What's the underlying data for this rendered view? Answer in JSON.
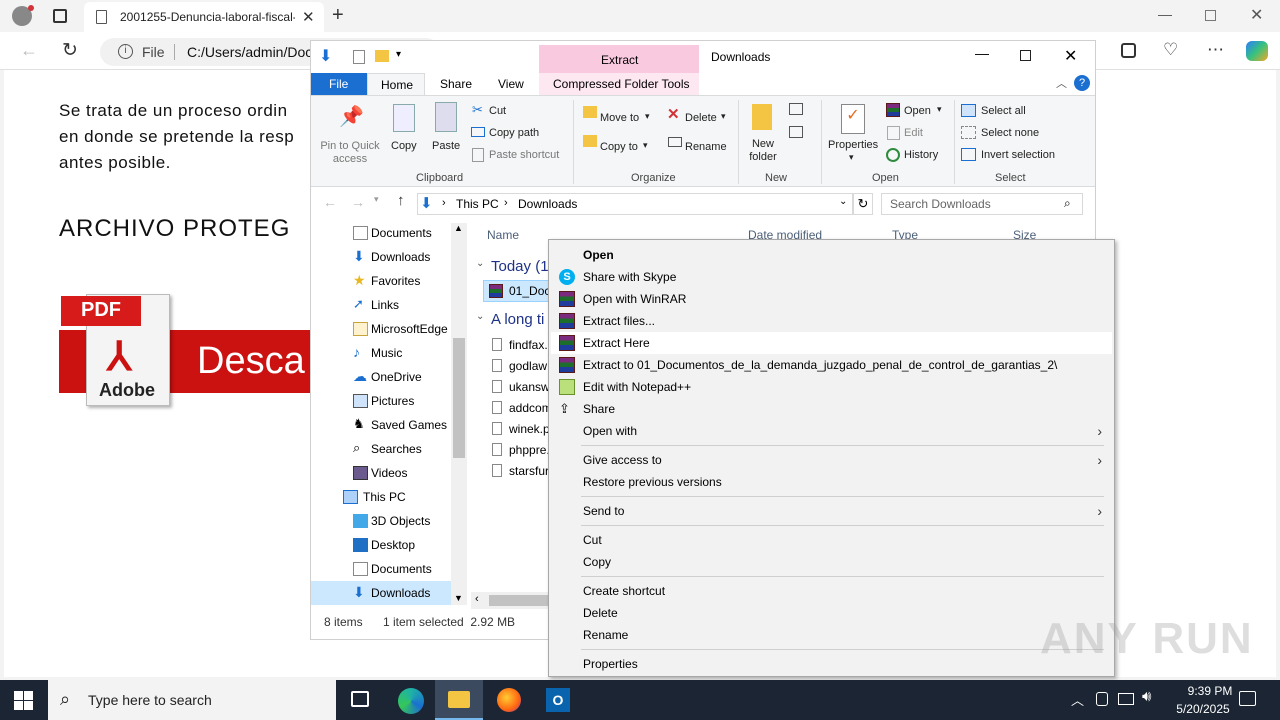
{
  "browser": {
    "tab_title": "2001255-Denuncia-laboral-fiscal-",
    "address_scheme": "File",
    "address_text": "C:/Users/admin/Doc"
  },
  "webpage": {
    "para_lines": [
      "Se trata de un proceso ordin",
      "en donde se pretende la resp",
      "antes posible."
    ],
    "heading": "ARCHIVO PROTEG",
    "pdf_label": "PDF",
    "adobe_label": "Adobe",
    "download_label": "Desca"
  },
  "explorer": {
    "ribbon_context_tab": "Extract",
    "window_title": "Downloads",
    "tabs": [
      "File",
      "Home",
      "Share",
      "View",
      "Compressed Folder Tools"
    ],
    "clipboard": {
      "pin": "Pin to Quick access",
      "copy": "Copy",
      "paste": "Paste",
      "cut": "Cut",
      "copy_path": "Copy path",
      "paste_shortcut": "Paste shortcut",
      "group": "Clipboard"
    },
    "organize": {
      "move_to": "Move to",
      "copy_to": "Copy to",
      "delete": "Delete",
      "rename": "Rename",
      "group": "Organize"
    },
    "new": {
      "new_folder": "New folder",
      "group": "New"
    },
    "open": {
      "properties": "Properties",
      "open": "Open",
      "edit": "Edit",
      "history": "History",
      "group": "Open"
    },
    "select": {
      "select_all": "Select all",
      "select_none": "Select none",
      "invert": "Invert selection",
      "group": "Select"
    },
    "path": [
      "This PC",
      "Downloads"
    ],
    "search_placeholder": "Search Downloads",
    "columns": [
      "Name",
      "Date modified",
      "Type",
      "Size"
    ],
    "groups": [
      "Today (1",
      "A long ti"
    ],
    "today_file": "01_Doc",
    "old_files": [
      "findfax.",
      "godlaw",
      "ukansw",
      "addcom",
      "winek.p",
      "phppre.",
      "starsfur"
    ],
    "nav_items": [
      "Documents",
      "Downloads",
      "Favorites",
      "Links",
      "MicrosoftEdge",
      "Music",
      "OneDrive",
      "Pictures",
      "Saved Games",
      "Searches",
      "Videos",
      "This PC",
      "3D Objects",
      "Desktop",
      "Documents",
      "Downloads"
    ],
    "status_count": "8 items",
    "status_selected": "1 item selected  2.92 MB"
  },
  "context_menu": [
    {
      "label": "Open",
      "bold": true
    },
    {
      "label": "Share with Skype"
    },
    {
      "label": "Open with WinRAR"
    },
    {
      "label": "Extract files..."
    },
    {
      "label": "Extract Here"
    },
    {
      "label": "Extract to 01_Documentos_de_la_demanda_juzgado_penal_de_control_de_garantias_2\\"
    },
    {
      "label": "Edit with Notepad++"
    },
    {
      "label": "Share"
    },
    {
      "label": "Open with"
    },
    {
      "label": "Give access to"
    },
    {
      "label": "Restore previous versions"
    },
    {
      "label": "Send to"
    },
    {
      "label": "Cut"
    },
    {
      "label": "Copy"
    },
    {
      "label": "Create shortcut"
    },
    {
      "label": "Delete"
    },
    {
      "label": "Rename"
    },
    {
      "label": "Properties"
    }
  ],
  "taskbar": {
    "search_placeholder": "Type here to search",
    "time": "9:39 PM",
    "date": "5/20/2025"
  },
  "watermark": "ANY RUN",
  "colors": {
    "accent": "#0078d4",
    "compressed_tab": "#f9c9e0",
    "pdf_red": "#cc1111",
    "taskbar": "#1b2533"
  }
}
